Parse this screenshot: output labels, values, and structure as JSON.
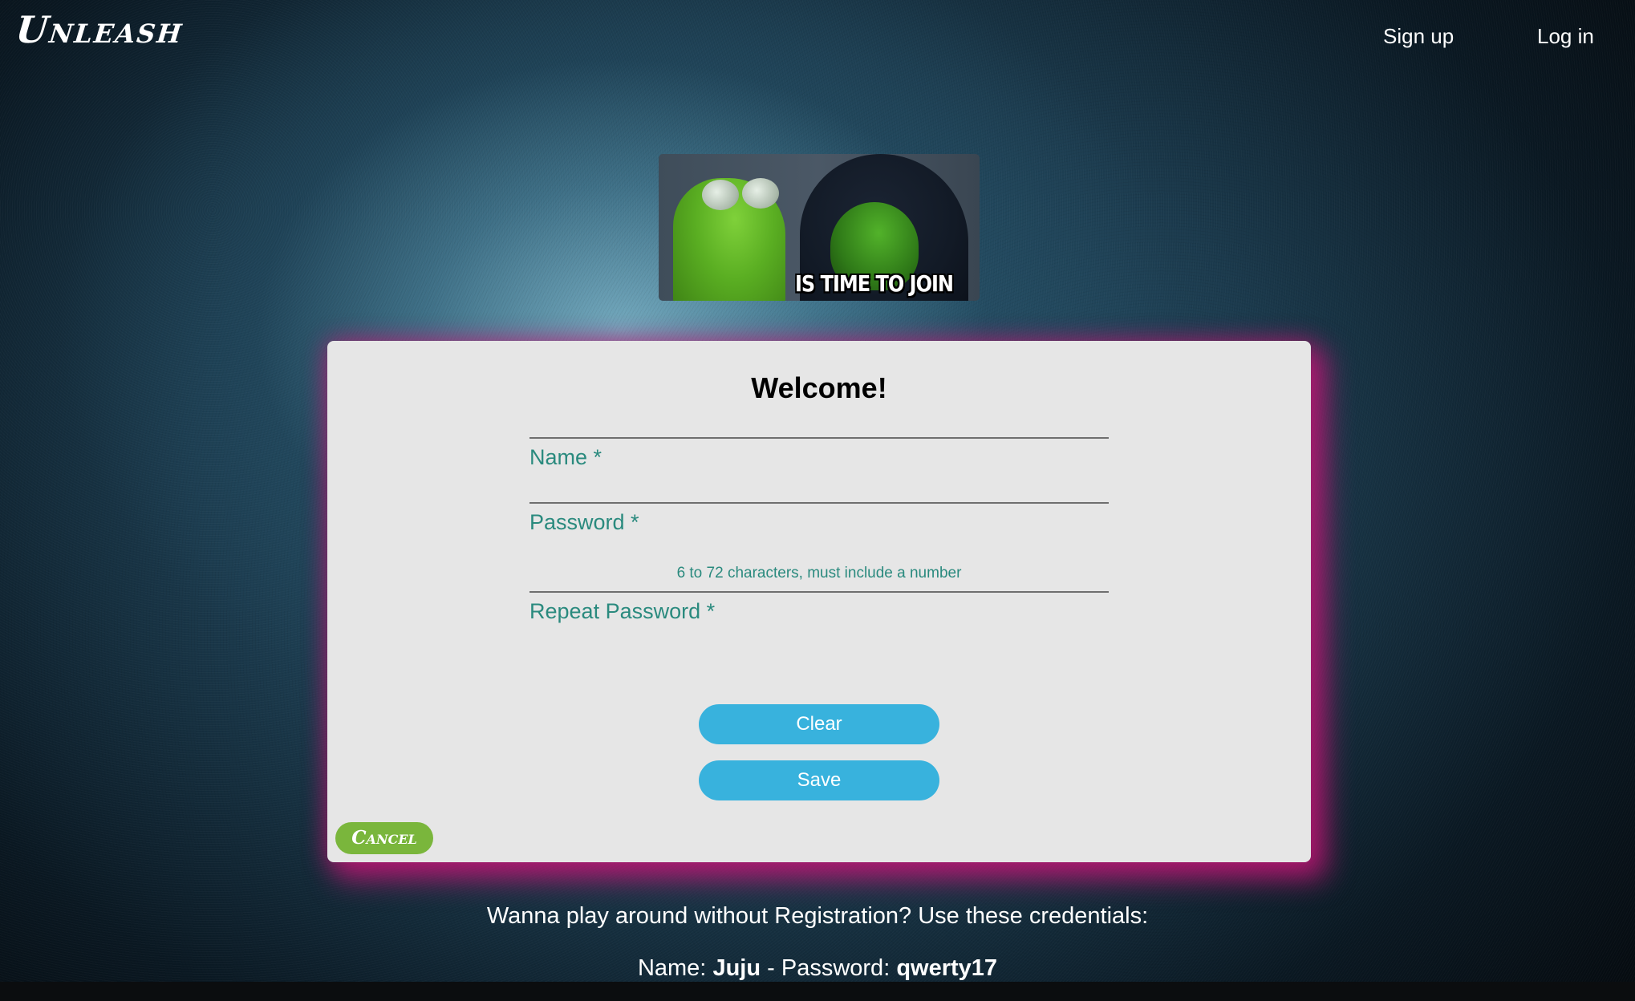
{
  "header": {
    "brand": "Unleash",
    "nav": {
      "signup_label": "Sign up",
      "login_label": "Log in"
    }
  },
  "banner": {
    "caption": "IS TIME TO JOIN"
  },
  "form": {
    "title": "Welcome!",
    "fields": {
      "name_label": "Name *",
      "password_label": "Password *",
      "password_hint": "6 to 72 characters, must include a number",
      "repeat_label": "Repeat Password *"
    },
    "buttons": {
      "clear_label": "Clear",
      "save_label": "Save",
      "cancel_label": "Cancel"
    }
  },
  "footer": {
    "guest_text": "Wanna play around without Registration? Use these credentials:",
    "name_prefix": "Name:",
    "name_value": "Juju",
    "separator": "-",
    "password_prefix": "Password:",
    "password_value": "qwerty17"
  },
  "colors": {
    "accent_button": "#38b2dd",
    "cancel_button": "#7ab63c",
    "label_teal": "#2a8a7e",
    "card_glow": "#c8147a",
    "card_bg": "#e6e6e6"
  }
}
